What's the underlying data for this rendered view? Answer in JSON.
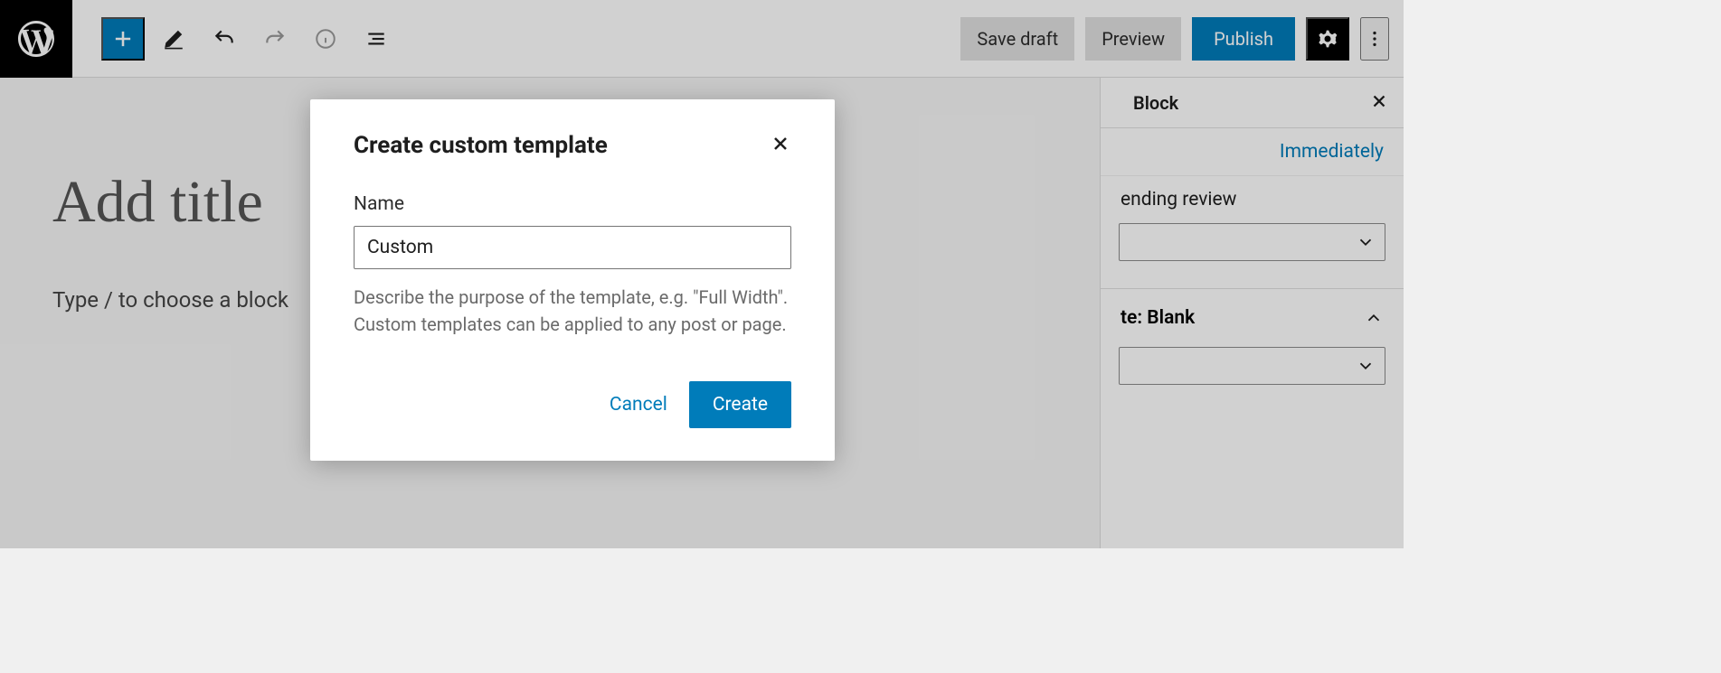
{
  "header": {
    "save_draft": "Save draft",
    "preview": "Preview",
    "publish": "Publish"
  },
  "editor": {
    "title_placeholder": "Add title",
    "block_placeholder": "Type / to choose a block"
  },
  "sidebar": {
    "tab_block": "Block",
    "publish_link": "Immediately",
    "pending_review": "ending review",
    "template_panel": "te: Blank"
  },
  "modal": {
    "title": "Create custom template",
    "name_label": "Name",
    "name_value": "Custom",
    "help_text": "Describe the purpose of the template, e.g. \"Full Width\". Custom templates can be applied to any post or page.",
    "cancel": "Cancel",
    "create": "Create"
  }
}
